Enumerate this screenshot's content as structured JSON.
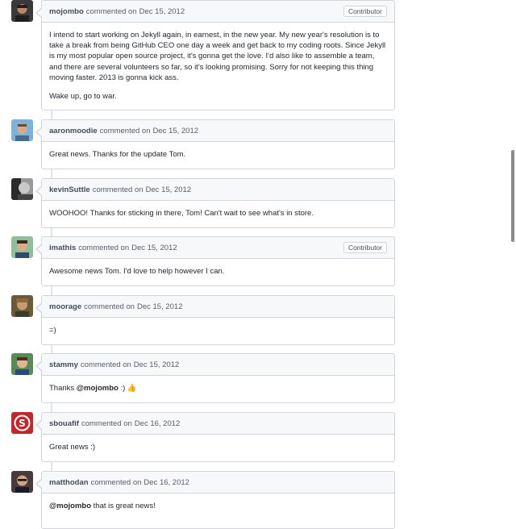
{
  "comments": [
    {
      "author": "mojombo",
      "action": "commented on",
      "date": "Dec 15, 2012",
      "badge": "Contributor",
      "body": [
        "I intend to start working on Jekyll again, in earnest, in the new year. My new year's resolution is to take a break from being GitHub CEO one day a week and get back to my coding roots. Since Jekyll is my most popular open source project, it's gonna get the love. I'd also like to assemble a team, and there are several volunteers so far, so it's looking promising. Sorry for not keeping this thing moving faster. 2013 is gonna kick ass.",
        "Wake up, go to war."
      ]
    },
    {
      "author": "aaronmoodie",
      "action": "commented on",
      "date": "Dec 15, 2012",
      "body": [
        "Great news. Thanks for the update Tom."
      ]
    },
    {
      "author": "kevinSuttle",
      "action": "commented on",
      "date": "Dec 15, 2012",
      "body": [
        "WOOHOO! Thanks for sticking in there, Tom! Can't wait to see what's in store."
      ]
    },
    {
      "author": "imathis",
      "action": "commented on",
      "date": "Dec 15, 2012",
      "badge": "Contributor",
      "body": [
        "Awesome news Tom. I'd love to help however I can."
      ]
    },
    {
      "author": "moorage",
      "action": "commented on",
      "date": "Dec 15, 2012",
      "body": [
        "=)"
      ]
    },
    {
      "author": "stammy",
      "action": "commented on",
      "date": "Dec 15, 2012",
      "body_prefix": "Thanks ",
      "mention": "@mojombo",
      "body_suffix": " :) 👍"
    },
    {
      "author": "sbouafif",
      "action": "commented on",
      "date": "Dec 16, 2012",
      "body": [
        "Great news :)"
      ]
    },
    {
      "author": "matthodan",
      "action": "commented on",
      "date": "Dec 16, 2012",
      "mention": "@mojombo",
      "body_suffix": " that is great news!"
    }
  ],
  "colors": {
    "header_bg": "#f6f8fa",
    "border": "#d1d5da",
    "sbouafif_avatar": "#c0262d"
  }
}
